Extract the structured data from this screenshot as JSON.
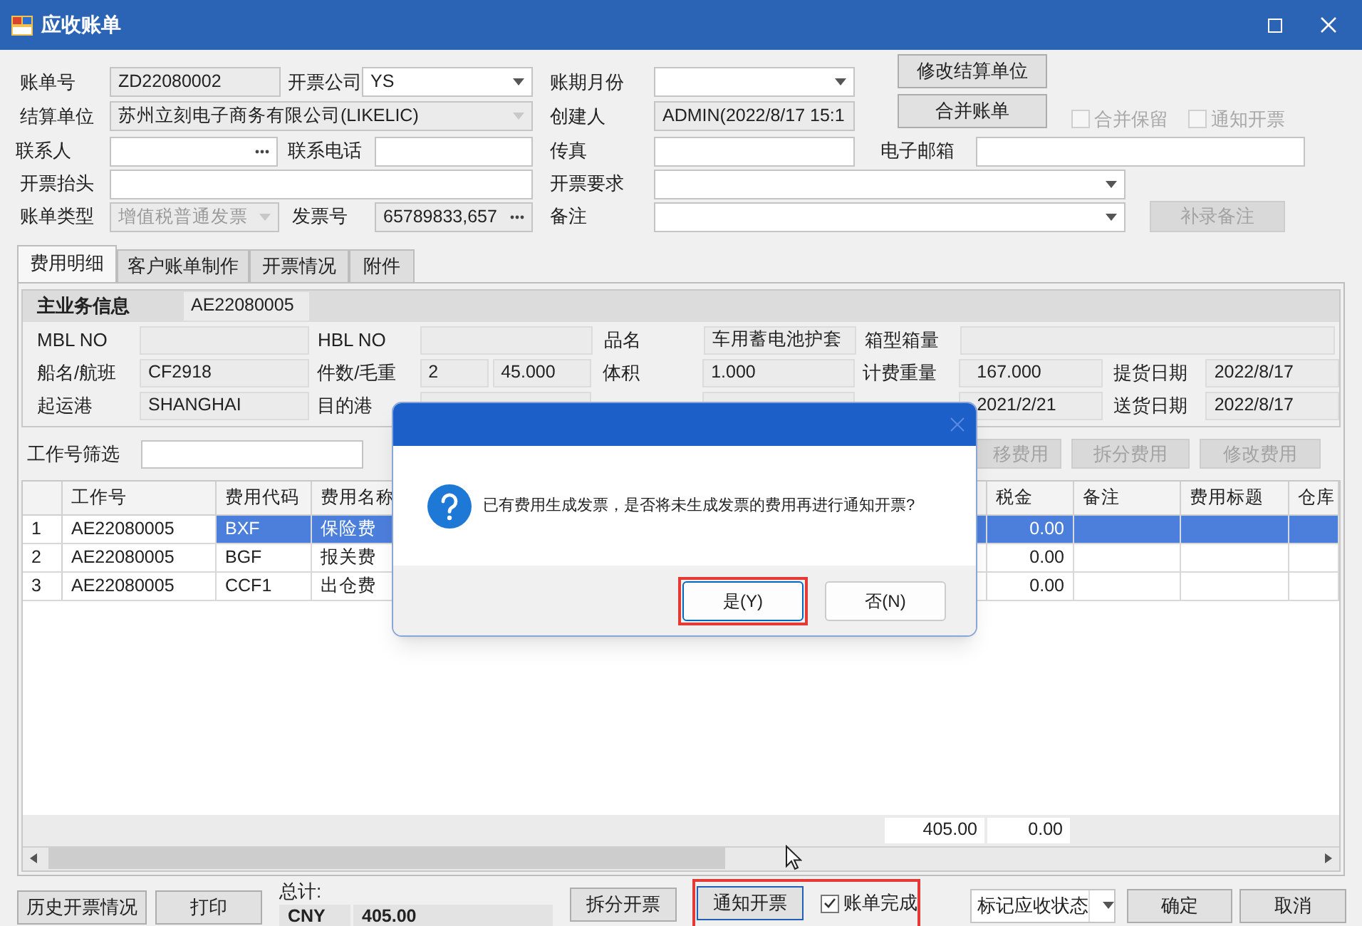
{
  "window": {
    "title": "应收账单"
  },
  "header": {
    "bill_no": {
      "label": "账单号",
      "readonly": true,
      "disabled": false,
      "value": "ZD22080002"
    },
    "invoice_company": {
      "label": "开票公司",
      "kind": "dropdown",
      "readonly": false,
      "disabled": false,
      "value": "YS"
    },
    "period_month": {
      "label": "账期月份",
      "kind": "dropdown",
      "readonly": false,
      "disabled": false
    },
    "settlement_unit": {
      "label": "结算单位",
      "kind": "dropdown",
      "readonly": true,
      "disabled": false,
      "value": "苏州立刻电子商务有限公司(LIKELIC)"
    },
    "creator": {
      "label": "创建人",
      "readonly": true,
      "disabled": false,
      "value": "ADMIN(2022/8/17 15:1"
    },
    "contact": {
      "label": "联系人",
      "kind": "lookup",
      "readonly": false,
      "disabled": false
    },
    "phone": {
      "label": "联系电话",
      "readonly": false,
      "disabled": false
    },
    "fax": {
      "label": "传真",
      "readonly": false,
      "disabled": false
    },
    "email": {
      "label": "电子邮箱",
      "readonly": false,
      "disabled": false
    },
    "invoice_title": {
      "label": "开票抬头",
      "readonly": false,
      "disabled": false
    },
    "invoice_requirement": {
      "label": "开票要求",
      "kind": "dropdown",
      "readonly": false,
      "disabled": false
    },
    "bill_type": {
      "label": "账单类型",
      "kind": "dropdown",
      "disabled": true,
      "value": "增值税普通发票"
    },
    "invoice_no": {
      "label": "发票号",
      "kind": "lookup",
      "readonly": true,
      "disabled": false,
      "value": "65789833,657"
    },
    "remark": {
      "label": "备注",
      "kind": "dropdown",
      "readonly": false,
      "disabled": false
    },
    "actions": [
      {
        "label": "修改结算单位",
        "disabled": false
      },
      {
        "label": "合并账单",
        "disabled": false
      }
    ],
    "options": [
      {
        "label": "合并保留",
        "checked": false,
        "disabled": true
      },
      {
        "label": "通知开票",
        "checked": false,
        "disabled": true
      }
    ],
    "supplement_button": {
      "label": "补录备注",
      "disabled": true
    }
  },
  "tabs": [
    {
      "label": "费用明细",
      "selected": true
    },
    {
      "label": "客户账单制作",
      "selected": false
    },
    {
      "label": "开票情况",
      "selected": false
    },
    {
      "label": "附件",
      "selected": false
    }
  ],
  "business_info": {
    "title": "主业务信息",
    "job_no": "AE22080005",
    "rows": [
      [
        {
          "label": "MBL NO"
        },
        {
          "label": "HBL NO"
        },
        {
          "label": "品名",
          "value": "车用蓄电池护套"
        },
        {
          "label": "箱型箱量"
        }
      ],
      [
        {
          "label": "船名/航班",
          "value": "CF2918"
        },
        {
          "label": "件数/毛重",
          "values": [
            "2",
            "45.000"
          ]
        },
        {
          "label": "体积",
          "value": "1.000"
        },
        {
          "label": "计费重量",
          "value": "167.000"
        },
        {
          "label": "提货日期",
          "value": "2022/8/17"
        }
      ],
      [
        {
          "label": "起运港",
          "value": "SHANGHAI"
        },
        {
          "label": "目的港"
        },
        null,
        {
          "value": "2021/2/21"
        },
        {
          "label": "送货日期",
          "value": "2022/8/17"
        }
      ]
    ]
  },
  "job_filter": {
    "label": "工作号筛选"
  },
  "fee_actions": [
    {
      "label": "移费用",
      "disabled": true
    },
    {
      "label": "拆分费用",
      "disabled": true
    },
    {
      "label": "修改费用",
      "disabled": true
    }
  ],
  "fee_table": {
    "columns": [
      "工作号",
      "费用代码",
      "费用名称",
      "税金",
      "备注",
      "费用标题",
      "仓库"
    ],
    "rows": [
      {
        "row_no": "1",
        "cells": [
          "AE22080005",
          "BXF",
          "保险费",
          "0.00"
        ],
        "selected": true
      },
      {
        "row_no": "2",
        "cells": [
          "AE22080005",
          "BGF",
          "报关费",
          "0.00"
        ],
        "selected": false
      },
      {
        "row_no": "3",
        "cells": [
          "AE22080005",
          "CCF1",
          "出仓费",
          "0.00"
        ],
        "selected": false
      }
    ],
    "totals": [
      "405.00",
      "0.00"
    ]
  },
  "footer": {
    "left_buttons": [
      "历史开票情况",
      "打印"
    ],
    "total": {
      "label": "总计:",
      "currency": "CNY",
      "amount": "405.00"
    },
    "split_button": "拆分开票",
    "highlighted": true,
    "notify_button": {
      "label": "通知开票",
      "focused": true
    },
    "complete": {
      "label": "账单完成",
      "checked": true
    },
    "status_select": {
      "value": "标记应收状态"
    },
    "confirm": "确定",
    "cancel": "取消"
  },
  "dialog": {
    "message": "已有费用生成发票，是否将未生成发票的费用再进行通知开票?",
    "buttons": [
      {
        "label": "是(Y)",
        "selected": true,
        "highlighted": true
      },
      {
        "label": "否(N)",
        "selected": false,
        "highlighted": false
      }
    ]
  }
}
